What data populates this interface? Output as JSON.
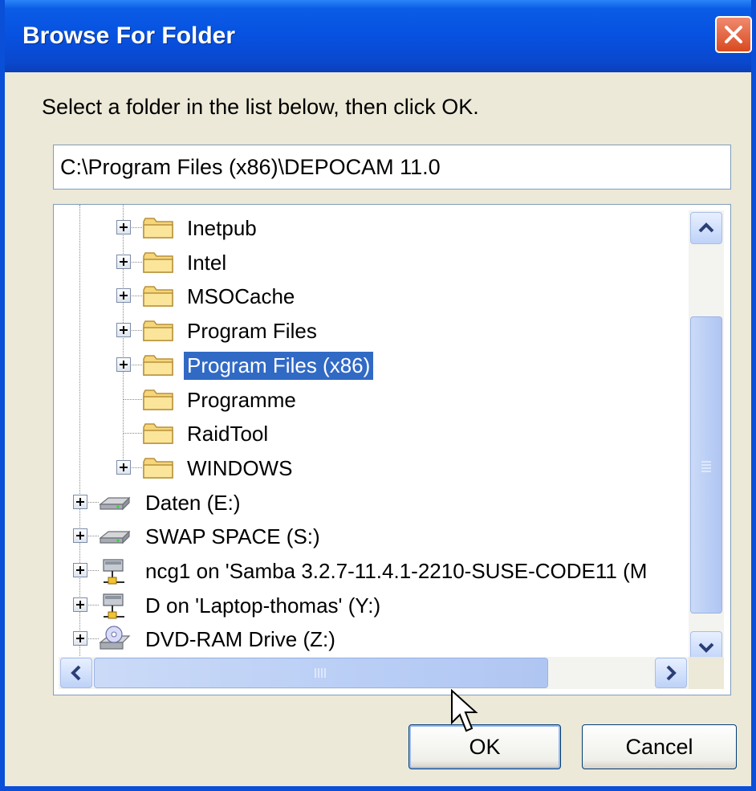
{
  "window": {
    "title": "Browse For Folder"
  },
  "prompt": "Select a folder in the list below, then click OK.",
  "path": "C:\\Program Files (x86)\\DEPOCAM 11.0",
  "tree": {
    "items": [
      {
        "label": "Inetpub",
        "icon": "folder-icon",
        "expandable": true
      },
      {
        "label": "Intel",
        "icon": "folder-icon",
        "expandable": true
      },
      {
        "label": "MSOCache",
        "icon": "folder-icon",
        "expandable": true
      },
      {
        "label": "Program Files",
        "icon": "folder-icon",
        "expandable": true
      },
      {
        "label": "Program Files (x86)",
        "icon": "folder-icon",
        "expandable": true,
        "selected": true
      },
      {
        "label": "Programme",
        "icon": "folder-icon",
        "expandable": false
      },
      {
        "label": "RaidTool",
        "icon": "folder-icon",
        "expandable": false
      },
      {
        "label": "WINDOWS",
        "icon": "folder-icon",
        "expandable": true
      },
      {
        "label": "Daten (E:)",
        "icon": "hard-drive-icon",
        "expandable": true
      },
      {
        "label": "SWAP SPACE (S:)",
        "icon": "hard-drive-icon",
        "expandable": true
      },
      {
        "label": "ncg1 on 'Samba 3.2.7-11.4.1-2210-SUSE-CODE11 (M",
        "icon": "network-drive-icon",
        "expandable": true
      },
      {
        "label": "D on 'Laptop-thomas' (Y:)",
        "icon": "network-drive-icon",
        "expandable": true
      },
      {
        "label": "DVD-RAM Drive (Z:)",
        "icon": "dvd-drive-icon",
        "expandable": true
      }
    ]
  },
  "buttons": {
    "ok": "OK",
    "cancel": "Cancel"
  },
  "colors": {
    "title_bar": "#0a5ce6",
    "selection": "#316ac5",
    "close_button": "#d84a20"
  }
}
